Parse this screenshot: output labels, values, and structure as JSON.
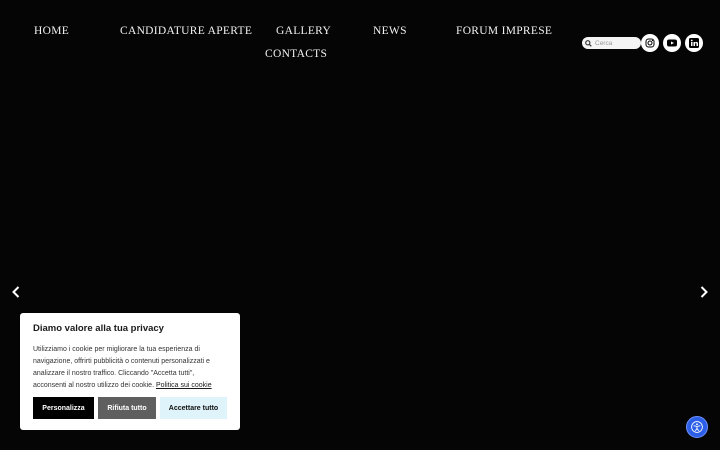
{
  "nav": {
    "items": [
      {
        "label": "HOME"
      },
      {
        "label": "CANDIDATURE APERTE"
      },
      {
        "label": "GALLERY"
      },
      {
        "label": "NEWS"
      },
      {
        "label": "FORUM IMPRESE"
      },
      {
        "label": "CONTACTS"
      }
    ]
  },
  "search": {
    "placeholder": "Cerca"
  },
  "social": [
    "instagram-icon",
    "youtube-icon",
    "linkedin-icon"
  ],
  "slider": {
    "prev_icon": "chevron-left-icon",
    "next_icon": "chevron-right-icon"
  },
  "cookie": {
    "title": "Diamo valore alla tua privacy",
    "text": "Utilizziamo i cookie per migliorare la tua esperienza di navigazione, offrirti pubblicità o contenuti personalizzati e analizzare il nostro traffico. Cliccando \"Accetta tutti\", acconsenti al nostro utilizzo dei cookie.",
    "policy_link": "Politica sui cookie",
    "customize_label": "Personalizza",
    "reject_label": "Rifiuta tutto",
    "accept_label": "Accettare tutto"
  },
  "colors": {
    "background": "#050505",
    "accept_button": "#dff3fa",
    "reject_button": "#5f5f5f",
    "accessibility": "#2c5ee8"
  }
}
